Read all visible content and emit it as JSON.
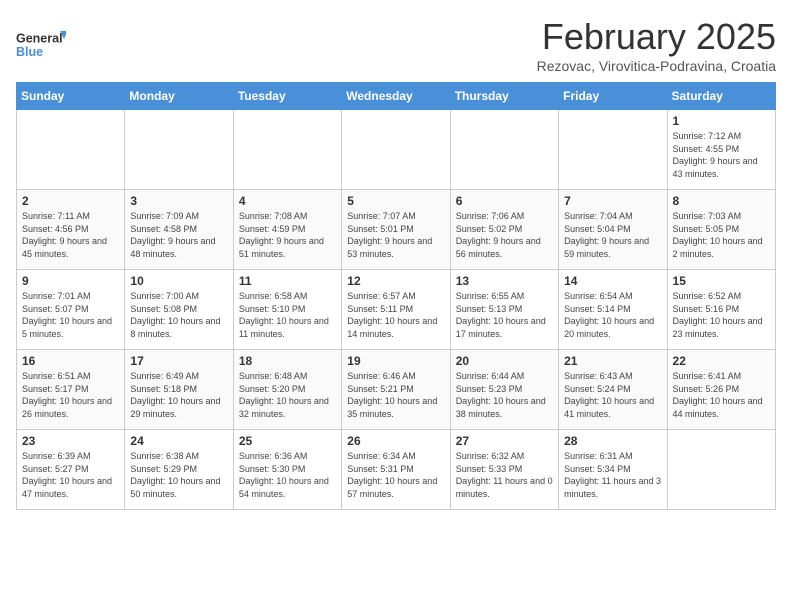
{
  "logo": {
    "general": "General",
    "blue": "Blue"
  },
  "title": "February 2025",
  "subtitle": "Rezovac, Virovitica-Podravina, Croatia",
  "days_header": [
    "Sunday",
    "Monday",
    "Tuesday",
    "Wednesday",
    "Thursday",
    "Friday",
    "Saturday"
  ],
  "weeks": [
    [
      {
        "day": "",
        "info": ""
      },
      {
        "day": "",
        "info": ""
      },
      {
        "day": "",
        "info": ""
      },
      {
        "day": "",
        "info": ""
      },
      {
        "day": "",
        "info": ""
      },
      {
        "day": "",
        "info": ""
      },
      {
        "day": "1",
        "info": "Sunrise: 7:12 AM\nSunset: 4:55 PM\nDaylight: 9 hours and 43 minutes."
      }
    ],
    [
      {
        "day": "2",
        "info": "Sunrise: 7:11 AM\nSunset: 4:56 PM\nDaylight: 9 hours and 45 minutes."
      },
      {
        "day": "3",
        "info": "Sunrise: 7:09 AM\nSunset: 4:58 PM\nDaylight: 9 hours and 48 minutes."
      },
      {
        "day": "4",
        "info": "Sunrise: 7:08 AM\nSunset: 4:59 PM\nDaylight: 9 hours and 51 minutes."
      },
      {
        "day": "5",
        "info": "Sunrise: 7:07 AM\nSunset: 5:01 PM\nDaylight: 9 hours and 53 minutes."
      },
      {
        "day": "6",
        "info": "Sunrise: 7:06 AM\nSunset: 5:02 PM\nDaylight: 9 hours and 56 minutes."
      },
      {
        "day": "7",
        "info": "Sunrise: 7:04 AM\nSunset: 5:04 PM\nDaylight: 9 hours and 59 minutes."
      },
      {
        "day": "8",
        "info": "Sunrise: 7:03 AM\nSunset: 5:05 PM\nDaylight: 10 hours and 2 minutes."
      }
    ],
    [
      {
        "day": "9",
        "info": "Sunrise: 7:01 AM\nSunset: 5:07 PM\nDaylight: 10 hours and 5 minutes."
      },
      {
        "day": "10",
        "info": "Sunrise: 7:00 AM\nSunset: 5:08 PM\nDaylight: 10 hours and 8 minutes."
      },
      {
        "day": "11",
        "info": "Sunrise: 6:58 AM\nSunset: 5:10 PM\nDaylight: 10 hours and 11 minutes."
      },
      {
        "day": "12",
        "info": "Sunrise: 6:57 AM\nSunset: 5:11 PM\nDaylight: 10 hours and 14 minutes."
      },
      {
        "day": "13",
        "info": "Sunrise: 6:55 AM\nSunset: 5:13 PM\nDaylight: 10 hours and 17 minutes."
      },
      {
        "day": "14",
        "info": "Sunrise: 6:54 AM\nSunset: 5:14 PM\nDaylight: 10 hours and 20 minutes."
      },
      {
        "day": "15",
        "info": "Sunrise: 6:52 AM\nSunset: 5:16 PM\nDaylight: 10 hours and 23 minutes."
      }
    ],
    [
      {
        "day": "16",
        "info": "Sunrise: 6:51 AM\nSunset: 5:17 PM\nDaylight: 10 hours and 26 minutes."
      },
      {
        "day": "17",
        "info": "Sunrise: 6:49 AM\nSunset: 5:18 PM\nDaylight: 10 hours and 29 minutes."
      },
      {
        "day": "18",
        "info": "Sunrise: 6:48 AM\nSunset: 5:20 PM\nDaylight: 10 hours and 32 minutes."
      },
      {
        "day": "19",
        "info": "Sunrise: 6:46 AM\nSunset: 5:21 PM\nDaylight: 10 hours and 35 minutes."
      },
      {
        "day": "20",
        "info": "Sunrise: 6:44 AM\nSunset: 5:23 PM\nDaylight: 10 hours and 38 minutes."
      },
      {
        "day": "21",
        "info": "Sunrise: 6:43 AM\nSunset: 5:24 PM\nDaylight: 10 hours and 41 minutes."
      },
      {
        "day": "22",
        "info": "Sunrise: 6:41 AM\nSunset: 5:26 PM\nDaylight: 10 hours and 44 minutes."
      }
    ],
    [
      {
        "day": "23",
        "info": "Sunrise: 6:39 AM\nSunset: 5:27 PM\nDaylight: 10 hours and 47 minutes."
      },
      {
        "day": "24",
        "info": "Sunrise: 6:38 AM\nSunset: 5:29 PM\nDaylight: 10 hours and 50 minutes."
      },
      {
        "day": "25",
        "info": "Sunrise: 6:36 AM\nSunset: 5:30 PM\nDaylight: 10 hours and 54 minutes."
      },
      {
        "day": "26",
        "info": "Sunrise: 6:34 AM\nSunset: 5:31 PM\nDaylight: 10 hours and 57 minutes."
      },
      {
        "day": "27",
        "info": "Sunrise: 6:32 AM\nSunset: 5:33 PM\nDaylight: 11 hours and 0 minutes."
      },
      {
        "day": "28",
        "info": "Sunrise: 6:31 AM\nSunset: 5:34 PM\nDaylight: 11 hours and 3 minutes."
      },
      {
        "day": "",
        "info": ""
      }
    ]
  ]
}
